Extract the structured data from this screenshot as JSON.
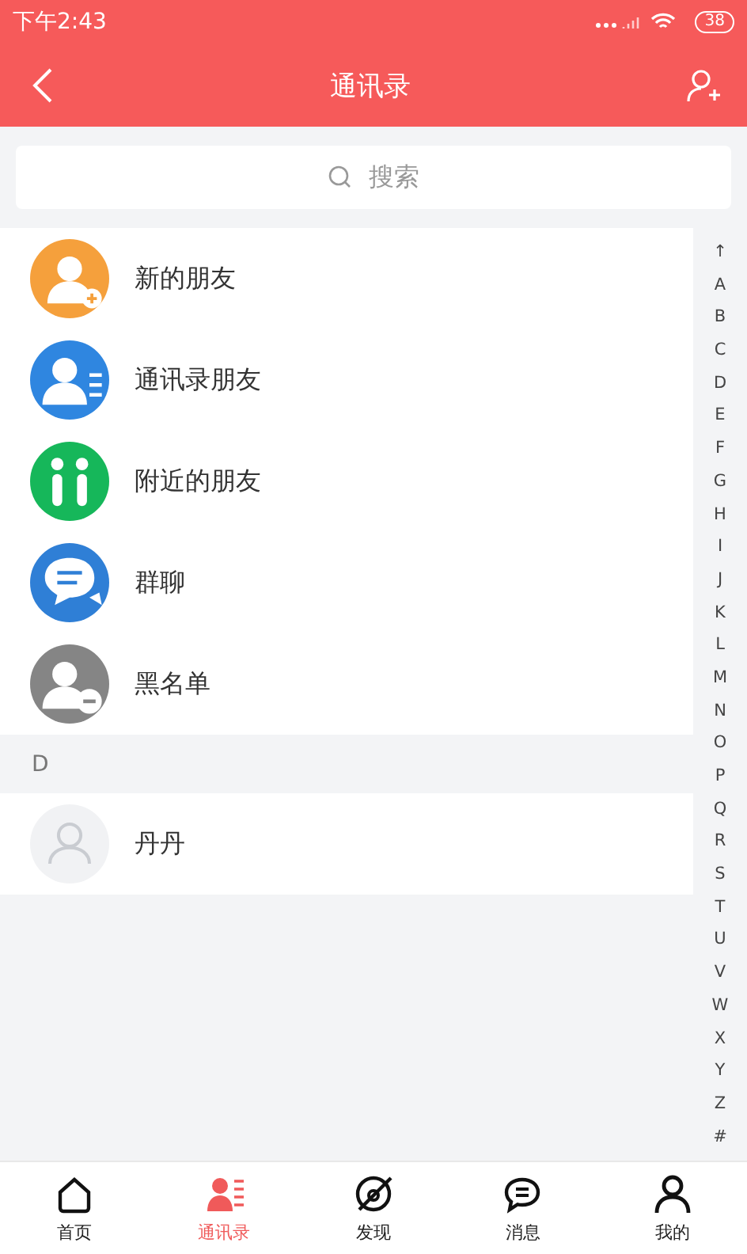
{
  "status_bar": {
    "time": "下午2:43",
    "battery": "38"
  },
  "header": {
    "title": "通讯录"
  },
  "search": {
    "placeholder": "搜索"
  },
  "menu_items": [
    {
      "label": "新的朋友",
      "kind": "add",
      "color": "#f5a03c"
    },
    {
      "label": "通讯录朋友",
      "kind": "list",
      "color": "#2f86e0"
    },
    {
      "label": "附近的朋友",
      "kind": "nearby",
      "color": "#16b75a"
    },
    {
      "label": "群聊",
      "kind": "chat",
      "color": "#2f7fd6"
    },
    {
      "label": "黑名单",
      "kind": "block",
      "color": "#858585"
    }
  ],
  "sections": [
    {
      "letter": "D",
      "contacts": [
        {
          "name": "丹丹"
        }
      ]
    }
  ],
  "index_letters": [
    "↑",
    "A",
    "B",
    "C",
    "D",
    "E",
    "F",
    "G",
    "H",
    "I",
    "J",
    "K",
    "L",
    "M",
    "N",
    "O",
    "P",
    "Q",
    "R",
    "S",
    "T",
    "U",
    "V",
    "W",
    "X",
    "Y",
    "Z",
    "#"
  ],
  "tabs": [
    {
      "label": "首页",
      "kind": "home",
      "selected": false
    },
    {
      "label": "通讯录",
      "kind": "contacts",
      "selected": true
    },
    {
      "label": "发现",
      "kind": "discover",
      "selected": false
    },
    {
      "label": "消息",
      "kind": "message",
      "selected": false
    },
    {
      "label": "我的",
      "kind": "me",
      "selected": false
    }
  ]
}
